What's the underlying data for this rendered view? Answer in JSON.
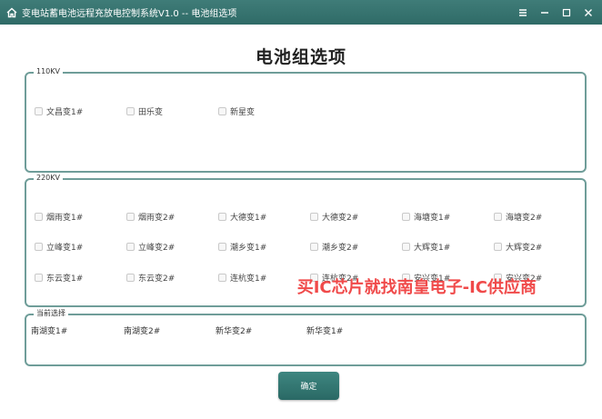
{
  "window": {
    "title": "变电站蓄电池远程充放电控制系统V1.0 -- 电池组选项",
    "icons": {
      "home": "home-icon",
      "menu": "menu-icon",
      "minimize": "minimize-icon",
      "maximize": "maximize-icon",
      "close": "close-icon"
    }
  },
  "page_title": "电池组选项",
  "group_110kv": {
    "label": "110KV",
    "items": [
      "文昌变1#",
      "田乐变",
      "新星变"
    ]
  },
  "group_220kv": {
    "label": "220KV",
    "rows": [
      [
        "烟雨变1#",
        "烟雨变2#",
        "大德变1#",
        "大德变2#",
        "海塘变1#",
        "海塘变2#"
      ],
      [
        "立峰变1#",
        "立峰变2#",
        "潮乡变1#",
        "潮乡变2#",
        "大辉变1#",
        "大辉变2#"
      ],
      [
        "东云变1#",
        "东云变2#",
        "连杭变1#",
        "连杭变2#",
        "安兴变1#",
        "安兴变2#"
      ]
    ]
  },
  "current_selection": {
    "label": "当前选择",
    "items": [
      "南湖变1#",
      "南湖变2#",
      "新华变2#",
      "新华变1#"
    ]
  },
  "confirm_label": "确定",
  "watermark": "买IC芯片就找南皇电子-IC供应商",
  "colors": {
    "titlebar": "#2f6b67",
    "border": "#6f9d99",
    "button": "#2a6965",
    "watermark": "#f04a4a"
  }
}
